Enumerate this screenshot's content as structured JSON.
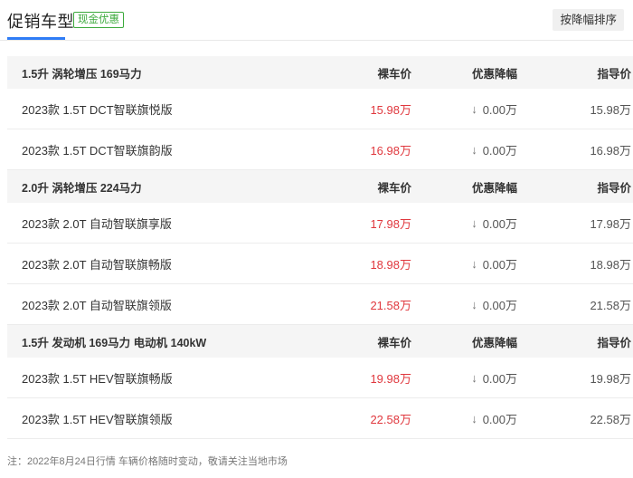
{
  "header": {
    "tab_title": "促销车型",
    "badge": "现金优惠",
    "sort_button": "按降幅排序"
  },
  "groups": [
    {
      "title": "1.5升 涡轮增压 169马力",
      "col_bare": "裸车价",
      "col_discount": "优惠降幅",
      "col_guide": "指导价",
      "rows": [
        {
          "name": "2023款 1.5T DCT智联旗悦版",
          "bare": "15.98万",
          "discount": "0.00万",
          "guide": "15.98万"
        },
        {
          "name": "2023款 1.5T DCT智联旗韵版",
          "bare": "16.98万",
          "discount": "0.00万",
          "guide": "16.98万"
        }
      ]
    },
    {
      "title": "2.0升 涡轮增压 224马力",
      "col_bare": "裸车价",
      "col_discount": "优惠降幅",
      "col_guide": "指导价",
      "rows": [
        {
          "name": "2023款 2.0T 自动智联旗享版",
          "bare": "17.98万",
          "discount": "0.00万",
          "guide": "17.98万"
        },
        {
          "name": "2023款 2.0T 自动智联旗畅版",
          "bare": "18.98万",
          "discount": "0.00万",
          "guide": "18.98万"
        },
        {
          "name": "2023款 2.0T 自动智联旗领版",
          "bare": "21.58万",
          "discount": "0.00万",
          "guide": "21.58万"
        }
      ]
    },
    {
      "title": "1.5升 发动机 169马力 电动机 140kW",
      "col_bare": "裸车价",
      "col_discount": "优惠降幅",
      "col_guide": "指导价",
      "rows": [
        {
          "name": "2023款 1.5T HEV智联旗畅版",
          "bare": "19.98万",
          "discount": "0.00万",
          "guide": "19.98万"
        },
        {
          "name": "2023款 1.5T HEV智联旗领版",
          "bare": "22.58万",
          "discount": "0.00万",
          "guide": "22.58万"
        }
      ]
    }
  ],
  "footnote": "注：2022年8月24日行情 车辆价格随时变动，敬请关注当地市场",
  "icons": {
    "discount_arrow": "arrow-down-icon"
  },
  "colors": {
    "accent": "#2f7cf6",
    "price": "#e0383e",
    "badge": "#3caa3c"
  }
}
